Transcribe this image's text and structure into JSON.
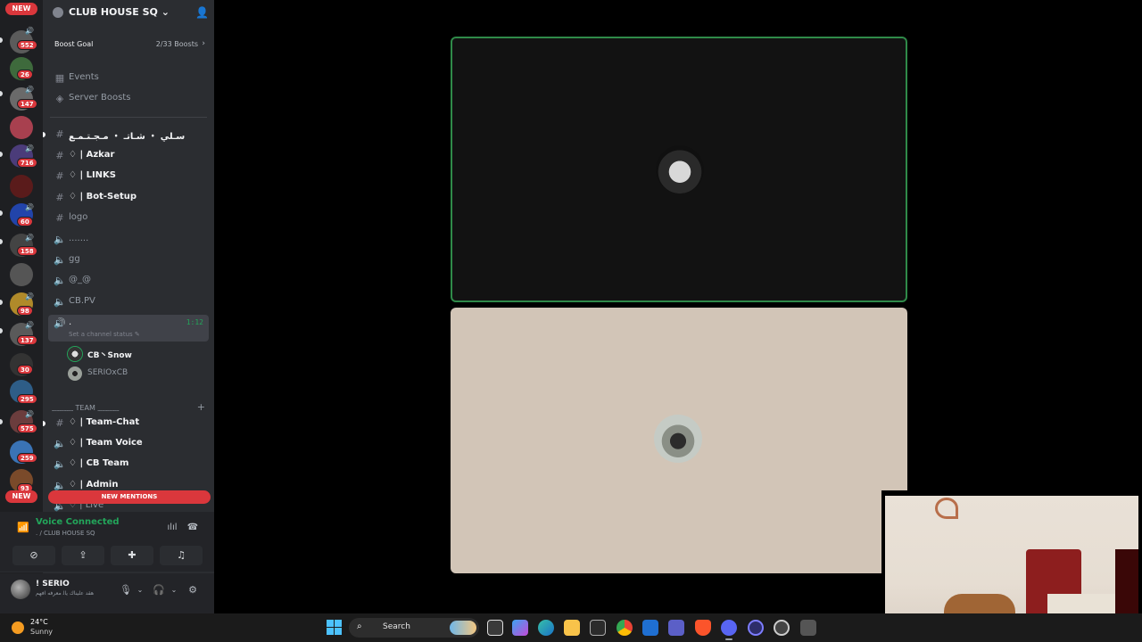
{
  "rail": {
    "new_top": "NEW",
    "new_bottom": "NEW",
    "badges": [
      "552",
      "26",
      "147",
      "716",
      "60",
      "158",
      "98",
      "137",
      "30",
      "295",
      "575",
      "259",
      "93"
    ]
  },
  "server": {
    "name": "CLUB HOUSE SQ",
    "boost_label": "Boost Goal",
    "boost_count": "2/33 Boosts"
  },
  "menu": {
    "events": "Events",
    "server_boosts": "Server Boosts"
  },
  "channels": [
    {
      "icon": "hash",
      "name": "سـلي ・ شـاتـ ・ مـجـتـمـع",
      "unread": true
    },
    {
      "icon": "hash",
      "name": "♢ | Azkar",
      "unread": true
    },
    {
      "icon": "hash",
      "name": "♢ | LINKS",
      "unread": true
    },
    {
      "icon": "hash",
      "name": "♢ | Bot-Setup",
      "unread": true
    },
    {
      "icon": "hash",
      "name": "logo",
      "unread": false
    },
    {
      "icon": "speaker",
      "name": ".......",
      "unread": false
    },
    {
      "icon": "speaker",
      "name": "gg",
      "unread": false
    },
    {
      "icon": "speaker",
      "name": "@_@",
      "unread": false
    },
    {
      "icon": "speaker",
      "name": "CB.PV",
      "unread": false
    }
  ],
  "active_voice": {
    "name": ".",
    "time": "1:12",
    "status_prompt": "Set a channel status ✎",
    "members": [
      {
        "name": "CB丶Snow",
        "bold": true
      },
      {
        "name": "SERIOxCB",
        "bold": false
      }
    ]
  },
  "category": {
    "label": "﹏﹏﹏ TEAM ﹏﹏﹏",
    "plus": "+"
  },
  "team_channels": [
    {
      "icon": "hash",
      "name": "♢ | Team-Chat",
      "unread": true
    },
    {
      "icon": "speaker",
      "name": "♢ | Team Voice",
      "unread": true
    },
    {
      "icon": "speaker",
      "name": "♢ | CB Team",
      "unread": true
    },
    {
      "icon": "speaker",
      "name": "♢ | Admin",
      "unread": true
    },
    {
      "icon": "speaker",
      "name": "♢ | Live",
      "unread": false
    }
  ],
  "new_mentions": "NEW MENTIONS",
  "voice": {
    "title": "Voice Connected",
    "subtitle": ". / CLUB HOUSE SQ"
  },
  "user": {
    "name": "! SERIO",
    "status": "ﻫﻘﺪ ﻋﻠﻴﻨﺎﻙ ﻳﺎﻟ ﻣﻌﺮﻓﻪ ﺍﻓﻬﻢ"
  },
  "taskbar": {
    "temperature": "24°C",
    "condition": "Sunny",
    "search_label": "Search"
  },
  "colors": {
    "accent_green": "#23a55a",
    "danger_red": "#da373c",
    "speaking_border": "#2f8a49"
  }
}
